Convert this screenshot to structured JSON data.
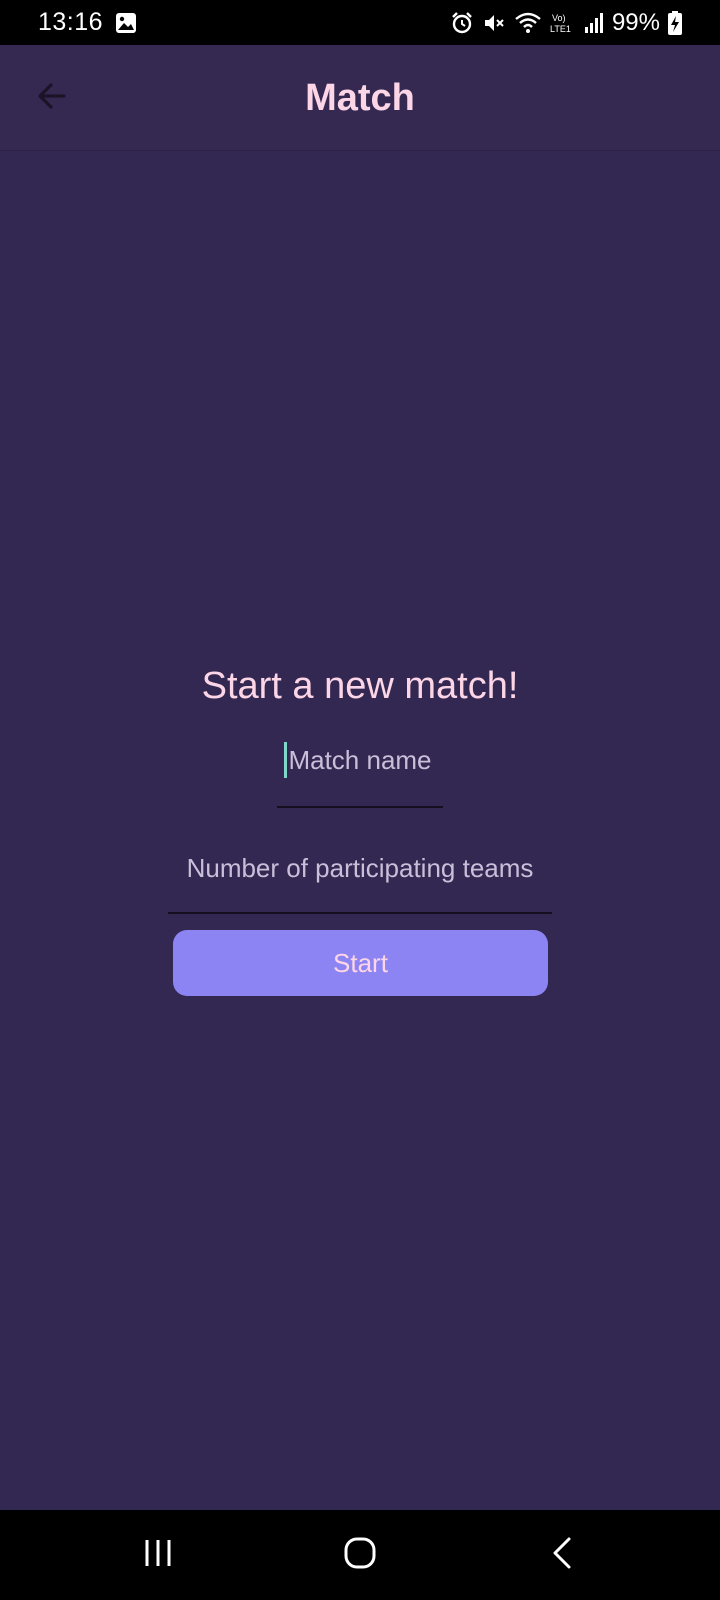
{
  "status_bar": {
    "time": "13:16",
    "battery": "99%",
    "icons": [
      "gallery-icon",
      "alarm-icon",
      "mute-icon",
      "wifi-icon",
      "lte-icon",
      "signal-icon",
      "battery-charging-icon"
    ],
    "lte_label": "Vo) LTE1"
  },
  "app_bar": {
    "title": "Match",
    "back_icon": "arrow-left-icon"
  },
  "form": {
    "heading": "Start a new match!",
    "match_name_placeholder": "Match name",
    "teams_placeholder": "Number of participating teams",
    "start_label": "Start"
  },
  "nav_bar": {
    "icons": [
      "recent-apps-icon",
      "home-icon",
      "back-icon"
    ]
  },
  "colors": {
    "background": "#332852",
    "app_bar": "#352952",
    "accent_text": "#fcd6e6",
    "button": "#8c84f2",
    "caret": "#7fd6c9"
  }
}
